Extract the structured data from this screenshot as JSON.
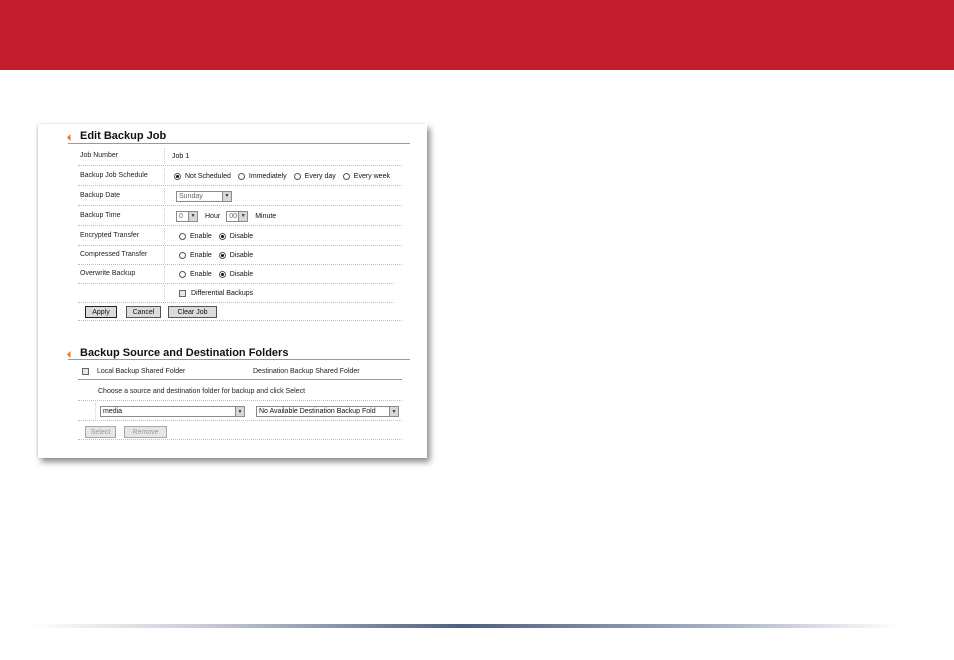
{
  "edit_section": {
    "title": "Edit Backup Job",
    "job_number": {
      "label": "Job Number",
      "value": "Job 1"
    },
    "schedule": {
      "label": "Backup Job Schedule",
      "options": [
        "Not Scheduled",
        "Immediately",
        "Every day",
        "Every week"
      ],
      "selected": "Not Scheduled"
    },
    "backup_date": {
      "label": "Backup Date",
      "value": "Sunday"
    },
    "backup_time": {
      "label": "Backup Time",
      "hour_value": "0",
      "hour_label": "Hour",
      "minute_value": "00",
      "minute_label": "Minute"
    },
    "encrypted": {
      "label": "Encrypted Transfer",
      "enable": "Enable",
      "disable": "Disable",
      "selected": "Disable"
    },
    "compressed": {
      "label": "Compressed Transfer",
      "enable": "Enable",
      "disable": "Disable",
      "selected": "Disable"
    },
    "overwrite": {
      "label": "Overwrite Backup",
      "enable": "Enable",
      "disable": "Disable",
      "selected": "Disable"
    },
    "differential": {
      "label": "Differential Backups",
      "checked": false
    },
    "buttons": {
      "apply": "Apply",
      "cancel": "Cancel",
      "clear_job": "Clear Job"
    }
  },
  "folders_section": {
    "title": "Backup Source and Destination Folders",
    "col_local": "Local Backup Shared Folder",
    "col_destination": "Destination Backup Shared Folder",
    "instruction": "Choose a source and destination folder for backup and click Select",
    "source_value": "media",
    "destination_value": "No Available Destination Backup Fold",
    "buttons": {
      "select": "Select",
      "remove": "Remove"
    }
  },
  "colors": {
    "banner": "#c41e2e",
    "accent_arrow": "#e87722"
  }
}
